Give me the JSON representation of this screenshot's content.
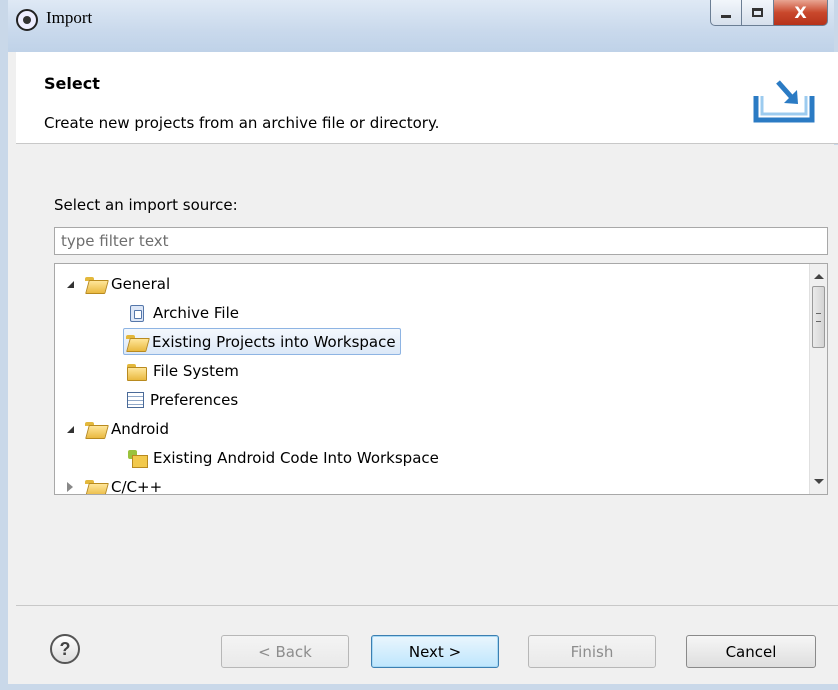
{
  "window": {
    "title": "Import",
    "controls": {
      "minimize_icon": "minimize-icon",
      "maximize_icon": "maximize-icon",
      "close_label": "X"
    }
  },
  "header": {
    "title": "Select",
    "description": "Create new projects from an archive file or directory."
  },
  "source": {
    "label": "Select an import source:",
    "filter_placeholder": "type filter text",
    "filter_value": ""
  },
  "tree": {
    "items": [
      {
        "label": "General",
        "icon": "folder-open-icon",
        "expanded": true
      },
      {
        "label": "Archive File",
        "icon": "archive-file-icon"
      },
      {
        "label": "Existing Projects into Workspace",
        "icon": "existing-projects-icon",
        "selected": true
      },
      {
        "label": "File System",
        "icon": "folder-icon"
      },
      {
        "label": "Preferences",
        "icon": "preferences-icon"
      },
      {
        "label": "Android",
        "icon": "folder-open-icon",
        "expanded": true
      },
      {
        "label": "Existing Android Code Into Workspace",
        "icon": "android-project-icon"
      },
      {
        "label": "C/C++",
        "icon": "folder-icon",
        "expanded": false
      }
    ]
  },
  "footer": {
    "help_glyph": "?",
    "back_label": "< Back",
    "next_label": "Next >",
    "finish_label": "Finish",
    "cancel_label": "Cancel"
  },
  "colors": {
    "selection_border": "#8eb4e3",
    "default_button": "#3c7fb1",
    "close_button": "#c9482c"
  }
}
